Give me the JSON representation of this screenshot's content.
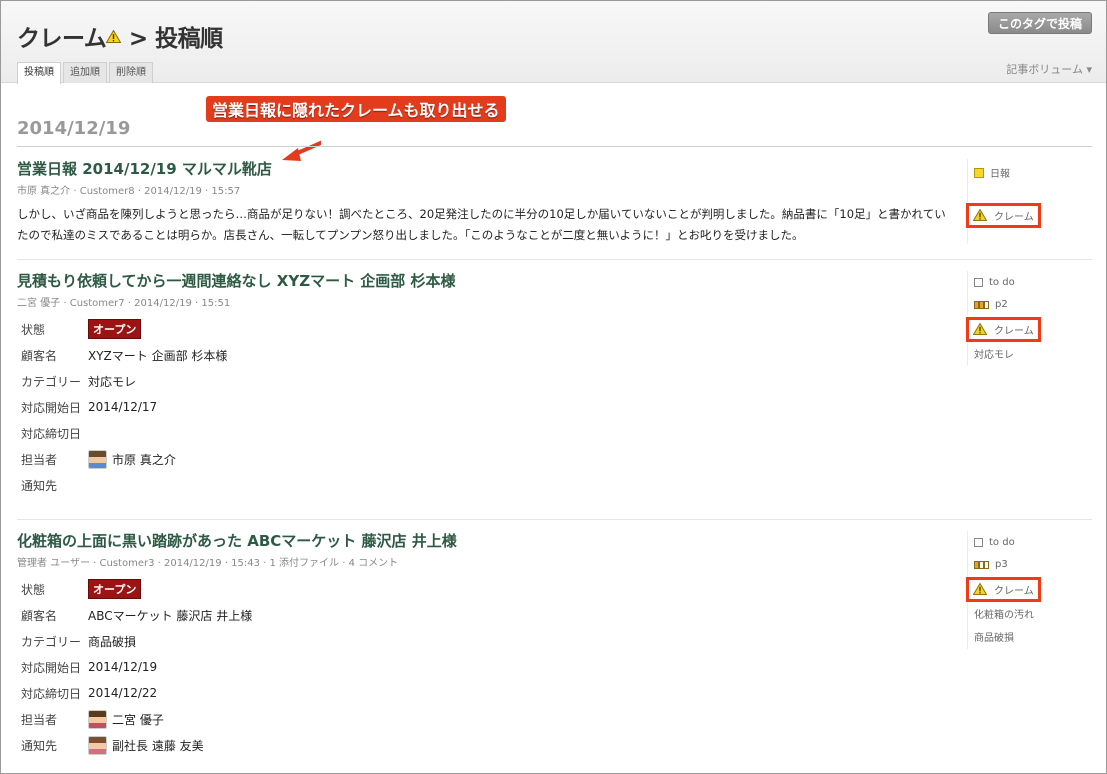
{
  "header": {
    "title_prefix": "クレーム",
    "title_suffix": " > 投稿順",
    "post_button": "このタグで投稿",
    "volume": "記事ボリューム ▾",
    "tabs": [
      "投稿順",
      "追加順",
      "削除順"
    ]
  },
  "annotation": "営業日報に隠れたクレームも取り出せる",
  "date": "2014/12/19",
  "colors": {
    "accent": "#e23c1c",
    "title": "#2e5a44",
    "badge": "#9b1312"
  },
  "entries": [
    {
      "title": "営業日報 2014/12/19 マルマル靴店",
      "meta": "市原 真之介 · Customer8 · 2014/12/19 · 15:57",
      "body": "しかし、いざ商品を陳列しようと思ったら…商品が足りない！調べたところ、20足発注したのに半分の10足しか届いていないことが判明しました。納品書に「10足」と書かれていたので私達のミスであることは明らか。店長さん、一転してプンプン怒り出しました。「このようなことが二度と無いように！」とお叱りを受けました。",
      "side": [
        "日報",
        "クレーム"
      ]
    },
    {
      "title": "見積もり依頼してから一週間連絡なし XYZマート 企画部 杉本様",
      "meta": "二宮 優子 · Customer7 · 2014/12/19 · 15:51",
      "fields": [
        {
          "label": "状態",
          "value": "オープン"
        },
        {
          "label": "顧客名",
          "value": "XYZマート 企画部 杉本様"
        },
        {
          "label": "カテゴリー",
          "value": "対応モレ"
        },
        {
          "label": "対応開始日",
          "value": "2014/12/17"
        },
        {
          "label": "対応締切日",
          "value": ""
        },
        {
          "label": "担当者",
          "value": "市原 真之介"
        },
        {
          "label": "通知先",
          "value": ""
        }
      ],
      "side": [
        "to do",
        "p2",
        "クレーム",
        "対応モレ"
      ]
    },
    {
      "title": "化粧箱の上面に黒い踏跡があった ABCマーケット 藤沢店 井上様",
      "meta": "管理者 ユーザー · Customer3 · 2014/12/19 · 15:43 · 1 添付ファイル · 4 コメント",
      "fields": [
        {
          "label": "状態",
          "value": "オープン"
        },
        {
          "label": "顧客名",
          "value": "ABCマーケット 藤沢店 井上様"
        },
        {
          "label": "カテゴリー",
          "value": "商品破損"
        },
        {
          "label": "対応開始日",
          "value": "2014/12/19"
        },
        {
          "label": "対応締切日",
          "value": "2014/12/22"
        },
        {
          "label": "担当者",
          "value": "二宮 優子"
        },
        {
          "label": "通知先",
          "value": "副社長 遠藤 友美"
        }
      ],
      "side": [
        "to do",
        "p3",
        "クレーム",
        "化粧箱の汚れ",
        "商品破損"
      ]
    }
  ]
}
